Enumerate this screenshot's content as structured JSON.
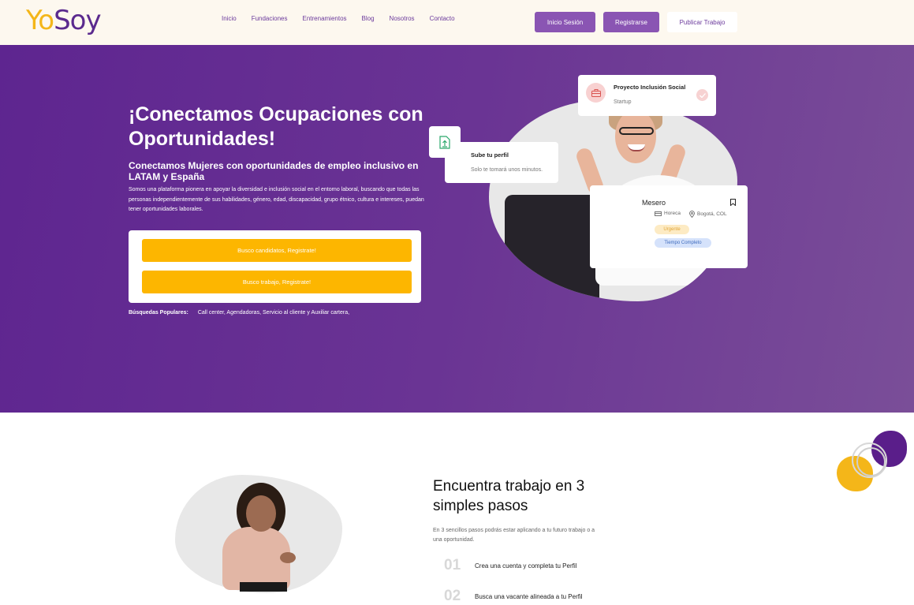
{
  "header": {
    "logo_yo": "Yo",
    "logo_soy": "Soy",
    "nav": [
      "Inicio",
      "Fundaciones",
      "Entrenamientos",
      "Blog",
      "Nosotros",
      "Contacto"
    ],
    "login_label": "Inicio Sesión",
    "register_label": "Registrarse",
    "publish_label": "Publicar Trabajo"
  },
  "hero": {
    "title": "¡Conectamos Ocupaciones con Oportunidades!",
    "subtitle": "Conectamos Mujeres con oportunidades de empleo inclusivo en LATAM y España",
    "description": "Somos una plataforma pionera en apoyar la diversidad e inclusión social en el entorno laboral, buscando que todas las personas independientemente de sus habilidades, género, edad, discapacidad, grupo étnico, cultura e intereses, puedan tener oportunidades laborales.",
    "cta_candidates": "Busco candidatos, Registrate!",
    "cta_job": "Busco trabajo, Registrate!",
    "popular_label": "Búsquedas Populares:",
    "popular_values": "Call center, Agendadoras, Servicio al cliente y Auxiliar cartera,"
  },
  "cards": {
    "project_title": "Proyecto Inclusión Social",
    "project_sub": "Startup",
    "upload_title": "Sube tu perfil",
    "upload_sub": "Solo te tomará unos minutos.",
    "job_title": "Mesero",
    "job_category": "Horeca",
    "job_location": "Bogotá, COL",
    "tag_urgent": "Urgente",
    "tag_fulltime": "Tiempo Completo"
  },
  "steps": {
    "title": "Encuentra trabajo en 3 simples pasos",
    "description": "En 3 sencillos pasos podrás estar aplicando a tu futuro trabajo o a una oportunidad.",
    "items": [
      {
        "num": "01",
        "text": "Crea una cuenta y completa tu Perfil"
      },
      {
        "num": "02",
        "text": "Busca una vacante alineada a tu Perfil"
      }
    ]
  },
  "colors": {
    "brand_purple": "#5e2590",
    "brand_yellow": "#fdb600",
    "button_purple": "#8a55b3"
  }
}
